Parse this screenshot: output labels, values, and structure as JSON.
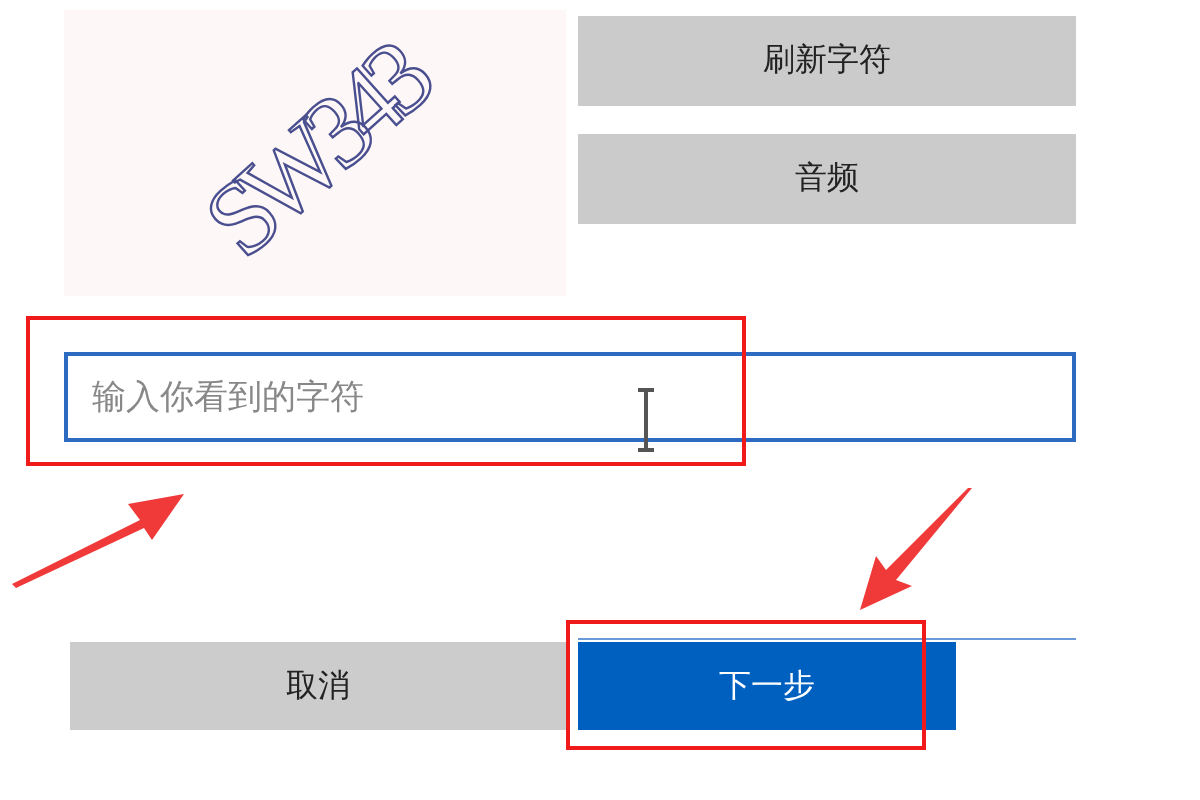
{
  "captcha": {
    "text": "SW343"
  },
  "side_buttons": [
    "刷新字符",
    "音频"
  ],
  "input": {
    "placeholder": "输入你看到的字符"
  },
  "buttons": [
    {
      "label": "取消",
      "kind": "secondary"
    },
    {
      "label": "下一步",
      "kind": "primary"
    }
  ]
}
